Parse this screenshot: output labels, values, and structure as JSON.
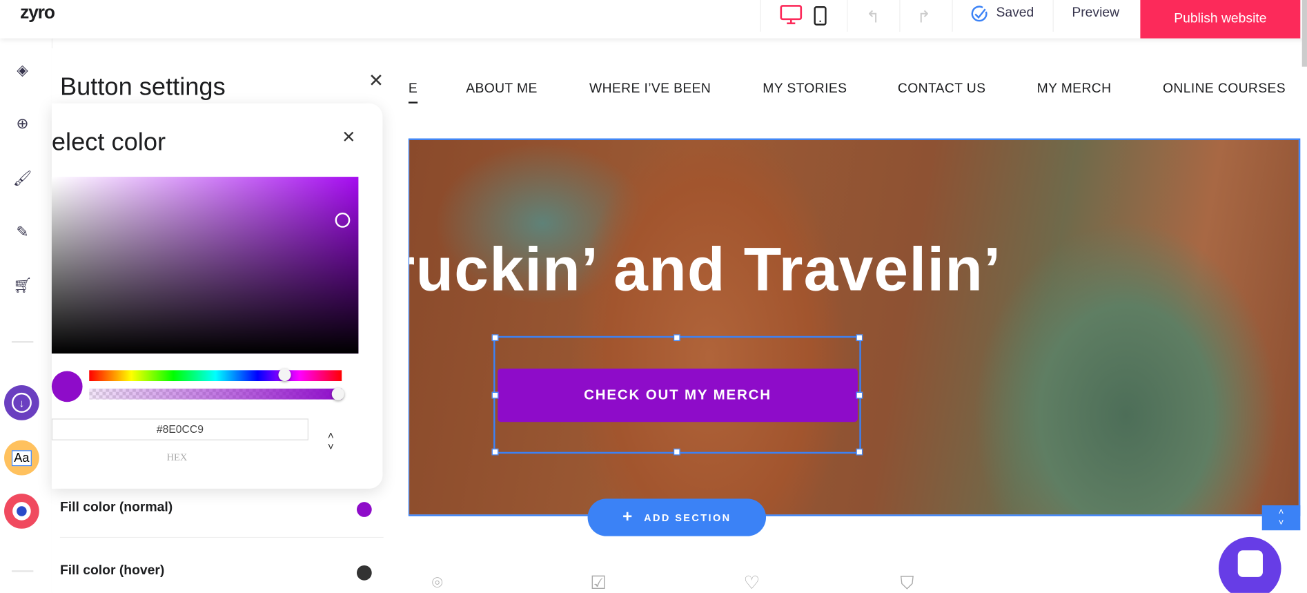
{
  "topbar": {
    "logo": "zyro",
    "saved": "Saved",
    "preview": "Preview",
    "publish": "Publish website",
    "device_active_color": "#fc2a5a"
  },
  "panel": {
    "title": "Button settings",
    "fill_normal": "Fill color (normal)",
    "fill_hover": "Fill color (hover)",
    "fill_normal_color": "#8E0CC9",
    "fill_hover_color": "#333333"
  },
  "color_picker": {
    "title": "elect color",
    "hex_value": "#8E0CC9",
    "mode_label": "HEX",
    "hue_percent": 77,
    "alpha_percent": 100
  },
  "site": {
    "nav": [
      "E",
      "ABOUT ME",
      "WHERE I’VE BEEN",
      "MY STORIES",
      "CONTACT US",
      "MY MERCH",
      "ONLINE COURSES"
    ],
    "hero_title": "ruckin’ and Travelin’",
    "cta": "CHECK OUT MY MERCH",
    "add_section": "ADD SECTION",
    "cta_color": "#8E0CC9"
  }
}
